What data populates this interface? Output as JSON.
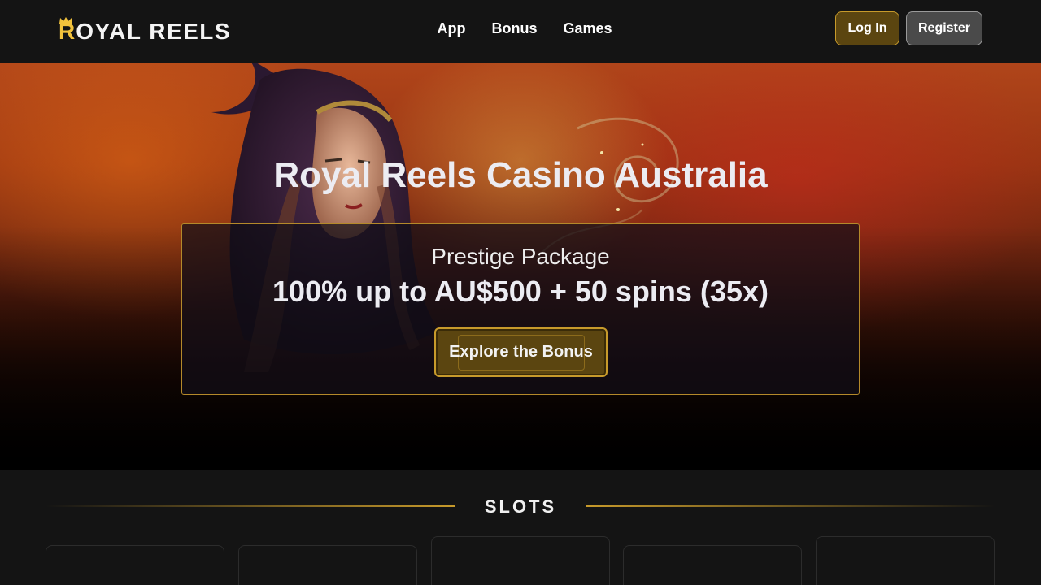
{
  "header": {
    "logo": {
      "first_letter": "R",
      "rest": "OYAL REELS"
    },
    "nav": [
      {
        "label": "App"
      },
      {
        "label": "Bonus"
      },
      {
        "label": "Games"
      }
    ],
    "login_label": "Log In",
    "register_label": "Register"
  },
  "hero": {
    "title": "Royal Reels Casino Australia",
    "bonus_subtitle": "Prestige Package",
    "bonus_offer": "100% up to AU$500 + 50 spins (35x)",
    "cta_label": "Explore the Bonus"
  },
  "slots": {
    "title": "SLOTS"
  },
  "colors": {
    "accent_gold": "#c79a2b",
    "logo_gold": "#f2c23c",
    "button_gold_bg": "#5b4510",
    "page_bg": "#141414"
  },
  "icons": [
    "crown-icon"
  ]
}
